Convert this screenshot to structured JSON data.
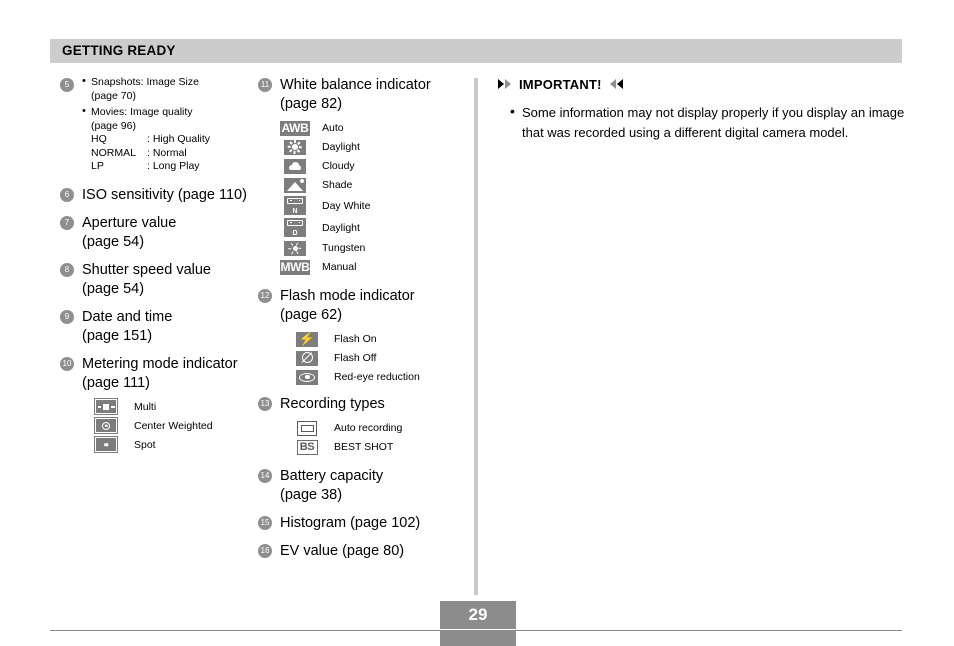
{
  "header": {
    "title": "GETTING READY"
  },
  "left_column": {
    "item5": {
      "number": "5",
      "lines": [
        {
          "type": "bullet",
          "text": "Snapshots: Image Size"
        },
        {
          "type": "sub",
          "text": "(page 70)"
        },
        {
          "type": "bullet",
          "text": "Movies: Image quality"
        },
        {
          "type": "sub",
          "text": "(page 96)"
        }
      ],
      "quality_table": [
        {
          "key": "HQ",
          "value": ": High Quality"
        },
        {
          "key": "NORMAL",
          "value": ": Normal"
        },
        {
          "key": "LP",
          "value": ": Long Play"
        }
      ]
    },
    "item6": {
      "number": "6",
      "text": "ISO sensitivity (page 110)"
    },
    "item7": {
      "number": "7",
      "text": "Aperture value",
      "text2": "(page 54)"
    },
    "item8": {
      "number": "8",
      "text": "Shutter speed value",
      "text2": "(page 54)"
    },
    "item9": {
      "number": "9",
      "text": "Date and time",
      "text2": "(page 151)"
    },
    "item10": {
      "number": "10",
      "text": "Metering mode indicator",
      "text2": "(page 111)",
      "modes": [
        {
          "icon": "metering-multi-icon",
          "label": "Multi"
        },
        {
          "icon": "metering-center-weighted-icon",
          "label": "Center Weighted"
        },
        {
          "icon": "metering-spot-icon",
          "label": "Spot"
        }
      ]
    }
  },
  "middle_column": {
    "item11": {
      "number": "11",
      "text": "White balance indicator",
      "text2": "(page 82)",
      "modes": [
        {
          "icon": "awb-text-icon",
          "icon_text": "AWB",
          "label": "Auto"
        },
        {
          "icon": "sun-icon",
          "label": "Daylight"
        },
        {
          "icon": "cloud-icon",
          "label": "Cloudy"
        },
        {
          "icon": "shade-house-icon",
          "label": "Shade"
        },
        {
          "icon": "fluorescent-day-white-icon",
          "icon_text": "N",
          "label": "Day White"
        },
        {
          "icon": "fluorescent-daylight-icon",
          "icon_text": "D",
          "label": "Daylight"
        },
        {
          "icon": "tungsten-bulb-icon",
          "label": "Tungsten"
        },
        {
          "icon": "mwb-text-icon",
          "icon_text": "MWB",
          "label": "Manual"
        }
      ]
    },
    "item12": {
      "number": "12",
      "text": "Flash mode indicator",
      "text2": "(page 62)",
      "modes": [
        {
          "icon": "flash-on-icon",
          "label": "Flash On"
        },
        {
          "icon": "flash-off-icon",
          "label": "Flash Off"
        },
        {
          "icon": "red-eye-reduction-icon",
          "label": "Red-eye reduction"
        }
      ]
    },
    "item13": {
      "number": "13",
      "text": "Recording types",
      "modes": [
        {
          "icon": "auto-recording-icon",
          "label": "Auto recording"
        },
        {
          "icon": "best-shot-icon",
          "icon_text": "BS",
          "label": "BEST SHOT"
        }
      ]
    },
    "item14": {
      "number": "14",
      "text": "Battery capacity",
      "text2": "(page 38)"
    },
    "item15": {
      "number": "15",
      "text": "Histogram (page 102)"
    },
    "item16": {
      "number": "16",
      "text": "EV value (page 80)"
    }
  },
  "right_column": {
    "important": {
      "heading": "IMPORTANT!",
      "bullet": "Some information may not display properly if you display an image that was recorded using a different digital camera model."
    }
  },
  "footer": {
    "page_number": "29"
  },
  "colors": {
    "header_bg": "#cccccc",
    "icon_gray": "#7d7d7d",
    "circle_gray": "#8f8f8f",
    "divider_gray": "#c9c9c9",
    "footer_gray": "#8c8c8c",
    "text": "#000000"
  }
}
